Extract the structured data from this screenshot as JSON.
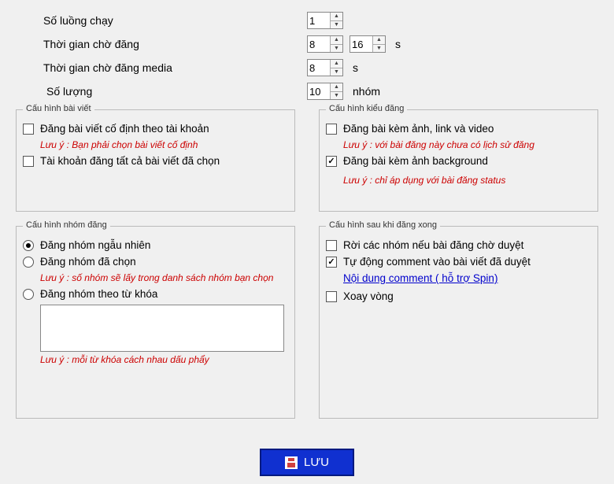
{
  "top": {
    "threads": {
      "label": "Số luồng chạy",
      "value": "1"
    },
    "wait_post": {
      "label": "Thời gian chờ đăng",
      "min": "8",
      "max": "16",
      "unit": "s"
    },
    "wait_media": {
      "label": "Thời gian chờ đăng media",
      "value": "8",
      "unit": "s"
    },
    "quantity": {
      "label": "Số lượng",
      "value": "10",
      "unit": "nhóm"
    }
  },
  "post_cfg": {
    "legend": "Cấu hình bài viết",
    "fixed_post": "Đăng bài viết cố định theo tài khoản",
    "fixed_note": "Lưu ý : Bạn phải chọn bài viết cố định",
    "all_posts": "Tài khoản đăng tất cả bài viết đã chọn"
  },
  "style_cfg": {
    "legend": "Cấu hình kiểu đăng",
    "media": "Đăng bài kèm ảnh, link và video",
    "media_note": "Lưu ý : với bài đăng này chưa có lịch sử đăng",
    "bg": "Đăng bài kèm ảnh background",
    "bg_note": "Lưu ý : chỉ áp dụng với bài đăng status"
  },
  "group_cfg": {
    "legend": "Cấu hình nhóm đăng",
    "random": "Đăng nhóm ngẫu nhiên",
    "chosen": "Đăng nhóm đã chọn",
    "chosen_note": "Lưu ý : số nhóm sẽ lấy trong danh sách nhóm bạn chọn",
    "keyword": "Đăng nhóm theo từ khóa",
    "kw_note": "Lưu ý : mỗi từ khóa cách nhau dấu phẩy"
  },
  "after_cfg": {
    "legend": "Cấu hình sau khi đăng xong",
    "leave": "Rời các nhóm nếu bài đăng chờ duyệt",
    "auto_cmt": "Tự động comment vào bài viết đã duyệt",
    "cmt_link": "Nội dung comment ( hỗ trợ Spin)",
    "rotate": "Xoay vòng"
  },
  "save": "LƯU"
}
